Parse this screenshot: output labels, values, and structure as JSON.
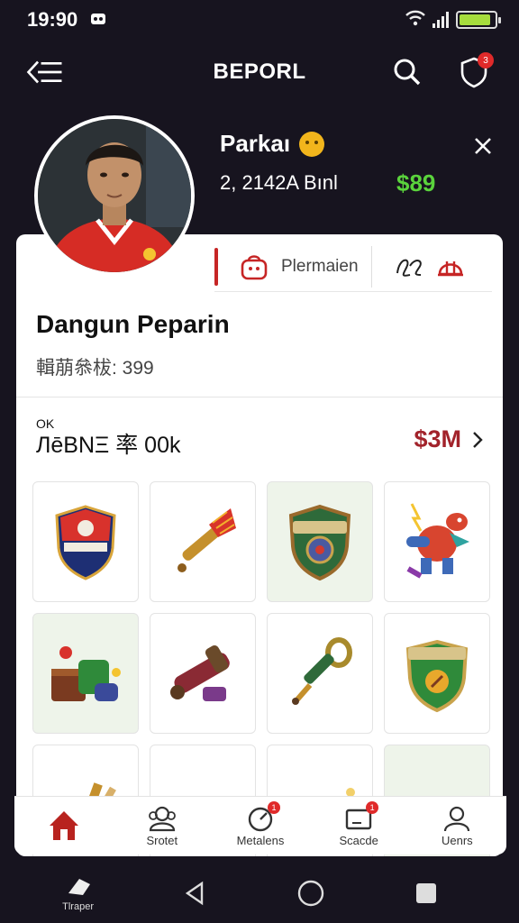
{
  "status_bar": {
    "time": "19:90",
    "battery_level": 0.9,
    "battery_color": "#a6dd3d"
  },
  "header": {
    "title": "BEPORL",
    "notification_count": "3"
  },
  "profile": {
    "name": "Parkaı",
    "stats": "2, 2142A Bınl",
    "money": "$89",
    "money_color": "#5ad33c"
  },
  "card": {
    "tabs": [
      {
        "label": "Plermaien"
      }
    ],
    "title": "Dangun Peparin",
    "subtitle": "輯萠叅柭: 399",
    "section_label": "ЛēBNΞ 率 00k",
    "section_label_sup": "OK",
    "section_value": "$3M"
  },
  "items": [
    {
      "icon": "crest-shield-icon",
      "bg": "gray"
    },
    {
      "icon": "golden-brush-icon",
      "bg": "white"
    },
    {
      "icon": "bronze-shield-icon",
      "bg": "green"
    },
    {
      "icon": "dragon-creature-icon",
      "bg": "white"
    },
    {
      "icon": "treasure-pack-icon",
      "bg": "green"
    },
    {
      "icon": "cannon-icon",
      "bg": "white"
    },
    {
      "icon": "golden-key-icon",
      "bg": "white"
    },
    {
      "icon": "green-badge-icon",
      "bg": "white"
    },
    {
      "icon": "sack-icon",
      "bg": "white"
    },
    {
      "icon": "round-emblem-icon",
      "bg": "white"
    },
    {
      "icon": "golden-wand-icon",
      "bg": "white"
    },
    {
      "icon": "red-box-icon",
      "bg": "green"
    }
  ],
  "bottom_nav": [
    {
      "label": "",
      "icon": "home-icon",
      "active": true
    },
    {
      "label": "Srotet",
      "icon": "people-icon"
    },
    {
      "label": "Metalens",
      "icon": "gauge-icon",
      "badge": "1"
    },
    {
      "label": "Scacde",
      "icon": "card-icon",
      "badge": "1"
    },
    {
      "label": "Uenrs",
      "icon": "user-icon"
    }
  ],
  "system_nav": {
    "tool_label": "Tlraper"
  },
  "accent_red": "#c62525"
}
